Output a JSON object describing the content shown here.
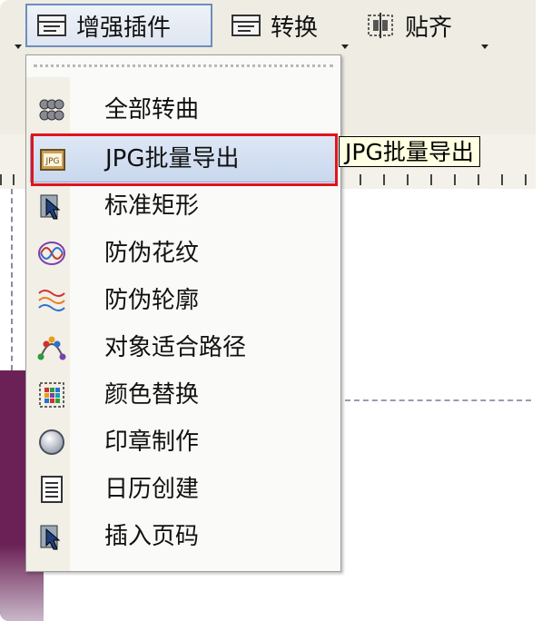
{
  "toolbar": {
    "buttons": [
      {
        "label": "增强插件",
        "icon": "plugin-icon"
      },
      {
        "label": "转换",
        "icon": "convert-icon"
      },
      {
        "label": "贴齐",
        "icon": "snap-icon"
      }
    ]
  },
  "tooltip": {
    "text": "JPG批量导出"
  },
  "menu": {
    "items": [
      {
        "label": "全部转曲",
        "icon": "curves-icon"
      },
      {
        "label": "JPG批量导出",
        "icon": "jpg-icon",
        "highlighted": true
      },
      {
        "label": "标准矩形",
        "icon": "rectangle-icon"
      },
      {
        "label": "防伪花纹",
        "icon": "pattern-icon"
      },
      {
        "label": "防伪轮廓",
        "icon": "outline-wave-icon"
      },
      {
        "label": "对象适合路径",
        "icon": "path-fit-icon"
      },
      {
        "label": "颜色替换",
        "icon": "color-replace-icon"
      },
      {
        "label": "印章制作",
        "icon": "stamp-icon"
      },
      {
        "label": "日历创建",
        "icon": "calendar-icon"
      },
      {
        "label": "插入页码",
        "icon": "page-number-icon"
      }
    ]
  },
  "colors": {
    "highlight_border": "#e0141c",
    "menu_highlight": "#c9d8ee",
    "tooltip_bg": "#ffffe1",
    "canvas_strip": "#6b2155"
  }
}
